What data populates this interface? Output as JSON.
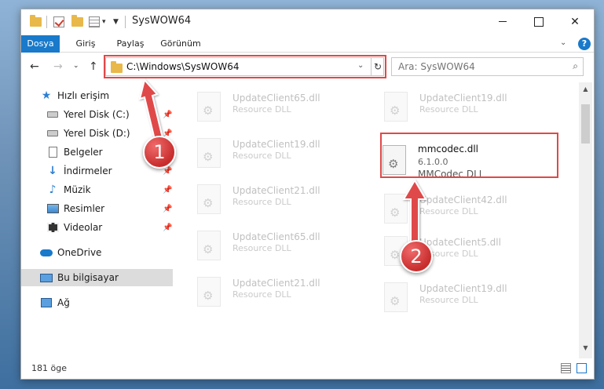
{
  "window": {
    "title": "SysWOW64"
  },
  "ribbon": {
    "tabs": [
      "Dosya",
      "Giriş",
      "Paylaş",
      "Görünüm"
    ],
    "help_label": "?"
  },
  "navbar": {
    "address": "C:\\Windows\\SysWOW64",
    "search_placeholder": "Ara: SysWOW64"
  },
  "sidebar": {
    "items": [
      {
        "label": "Hızlı erişim",
        "icon": "star-icon",
        "pinned": false
      },
      {
        "label": "Yerel Disk (C:)",
        "icon": "drive-icon",
        "pinned": true
      },
      {
        "label": "Yerel Disk (D:)",
        "icon": "drive-icon",
        "pinned": true
      },
      {
        "label": "Belgeler",
        "icon": "document-icon",
        "pinned": true
      },
      {
        "label": "İndirmeler",
        "icon": "download-icon",
        "pinned": true
      },
      {
        "label": "Müzik",
        "icon": "music-icon",
        "pinned": true
      },
      {
        "label": "Resimler",
        "icon": "pictures-icon",
        "pinned": true
      },
      {
        "label": "Videolar",
        "icon": "video-icon",
        "pinned": true
      },
      {
        "label": "OneDrive",
        "icon": "cloud-icon",
        "pinned": false
      },
      {
        "label": "Bu bilgisayar",
        "icon": "computer-icon",
        "pinned": false,
        "selected": true
      },
      {
        "label": "Ağ",
        "icon": "network-icon",
        "pinned": false
      }
    ]
  },
  "files": {
    "left": [
      {
        "name": "UpdateClient65.dll",
        "desc": "Resource DLL"
      },
      {
        "name": "UpdateClient19.dll",
        "desc": "Resource DLL"
      },
      {
        "name": "UpdateClient21.dll",
        "desc": "Resource DLL"
      },
      {
        "name": "UpdateClient65.dll",
        "desc": "Resource DLL"
      },
      {
        "name": "UpdateClient21.dll",
        "desc": "Resource DLL"
      }
    ],
    "right": [
      {
        "name": "UpdateClient19.dll",
        "desc": "Resource DLL"
      },
      {
        "name": "mmcodec.dll",
        "version": "6.1.0.0",
        "desc": "MMCodec DLL",
        "highlighted": true
      },
      {
        "name": "UpdateClient42.dll",
        "desc": "Resource DLL"
      },
      {
        "name": "UpdateClient5.dll",
        "desc": "Resource DLL"
      },
      {
        "name": "UpdateClient19.dll",
        "desc": "Resource DLL"
      }
    ]
  },
  "status": {
    "count": "181 öge"
  },
  "annotations": {
    "step1": "1",
    "step2": "2",
    "color": "#e04848"
  }
}
